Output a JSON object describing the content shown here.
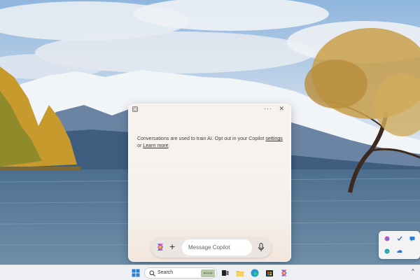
{
  "copilot": {
    "notice_prefix": "Conversations are used to train AI. Opt out in your Copilot ",
    "settings_link": "settings",
    "notice_or": " or ",
    "learn_more_link": "Learn more",
    "notice_suffix": ".",
    "more_menu": "···",
    "close": "✕",
    "composer": {
      "placeholder": "Message Copilot",
      "plus": "+"
    }
  },
  "taskbar": {
    "search_label": "Search",
    "search_badge": "Microsoft",
    "pinned": [
      "windows-start-icon",
      "task-view-icon",
      "file-explorer-icon",
      "edge-icon",
      "microsoft-store-icon",
      "copilot-icon"
    ],
    "overflow": "^"
  },
  "tray_flyout": {
    "icons": [
      "copilot-icon",
      "todo-check-icon",
      "message-icon",
      "edge-icon",
      "onedrive-icon"
    ]
  }
}
